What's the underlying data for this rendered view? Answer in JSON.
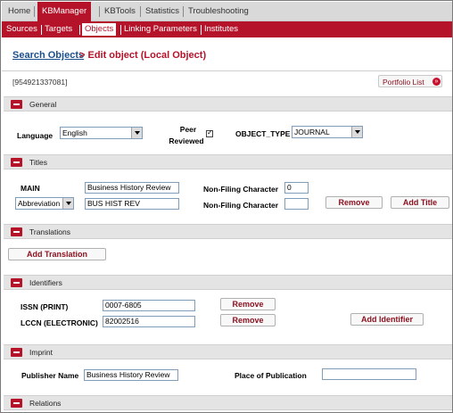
{
  "topnav": {
    "tabs": [
      {
        "label": "Home"
      },
      {
        "label": "KBManager"
      },
      {
        "label": "KBTools"
      },
      {
        "label": "Statistics"
      },
      {
        "label": "Troubleshooting"
      }
    ],
    "active": "KBManager"
  },
  "subnav": {
    "items": [
      {
        "label": "Sources"
      },
      {
        "label": "Targets"
      },
      {
        "label": "Objects"
      },
      {
        "label": "Linking Parameters"
      },
      {
        "label": "Institutes"
      }
    ],
    "active": "Objects"
  },
  "header": {
    "link": "Search Objects",
    "rest": "> Edit object (Local Object)"
  },
  "object_id": "[954921337081]",
  "portfolio_list": "Portfolio List",
  "sections": {
    "general": "General",
    "titles": "Titles",
    "translations": "Translations",
    "identifiers": "Identifiers",
    "imprint": "Imprint",
    "relations": "Relations"
  },
  "general": {
    "language_label": "Language",
    "language_value": "English",
    "peer_label_1": "Peer",
    "peer_label_2": "Reviewed",
    "peer_checked": true,
    "object_type_label": "OBJECT_TYPE",
    "object_type_value": "JOURNAL"
  },
  "titles": {
    "main_label": "MAIN",
    "main_value": "Business History Review",
    "nonfiling_label": "Non-Filing Character",
    "nonfiling_main": "0",
    "abbr_select": "Abbreviation",
    "abbr_value": "BUS HIST REV",
    "nonfiling_abbr": "",
    "remove": "Remove",
    "add_title": "Add Title"
  },
  "translations": {
    "add": "Add Translation"
  },
  "identifiers": {
    "issn_label": "ISSN (PRINT)",
    "issn_value": "0007-6805",
    "lccn_label": "LCCN (ELECTRONIC)",
    "lccn_value": "82002516",
    "remove": "Remove",
    "add": "Add Identifier"
  },
  "imprint": {
    "publisher_label": "Publisher Name",
    "publisher_value": "Business History Review",
    "place_label": "Place of Publication",
    "place_value": ""
  },
  "colors": {
    "brand": "#b5132a",
    "link": "#1b4f8c"
  }
}
